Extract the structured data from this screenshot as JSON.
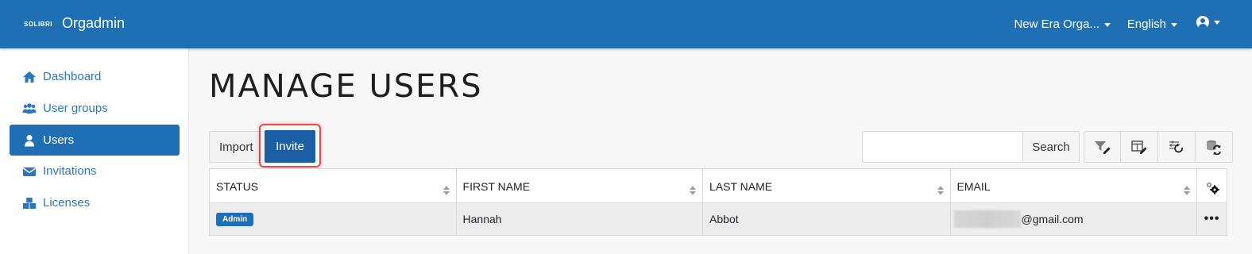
{
  "header": {
    "logo_text": "SOLIBRI",
    "app_title": "Orgadmin",
    "org_menu": "New Era Orga...",
    "language_menu": "English"
  },
  "sidebar": {
    "items": [
      {
        "label": "Dashboard",
        "icon": "home-icon"
      },
      {
        "label": "User groups",
        "icon": "users-icon"
      },
      {
        "label": "Users",
        "icon": "user-icon",
        "active": true
      },
      {
        "label": "Invitations",
        "icon": "envelope-icon"
      },
      {
        "label": "Licenses",
        "icon": "boxes-icon"
      }
    ]
  },
  "main": {
    "title": "MANAGE USERS",
    "import_label": "Import",
    "invite_label": "Invite",
    "search_placeholder": "",
    "search_label": "Search",
    "tools": [
      "filter-edit-icon",
      "columns-edit-icon",
      "reset-filters-icon",
      "refresh-data-icon"
    ]
  },
  "table": {
    "columns": [
      "STATUS",
      "FIRST NAME",
      "LAST NAME",
      "EMAIL"
    ],
    "rows": [
      {
        "status": "Admin",
        "first_name": "Hannah",
        "last_name": "Abbot",
        "email_visible": "@gmail.com"
      }
    ]
  },
  "colors": {
    "brand": "#1f6fb5",
    "invite_button": "#1a5fa3",
    "highlight": "#e24b4b"
  }
}
